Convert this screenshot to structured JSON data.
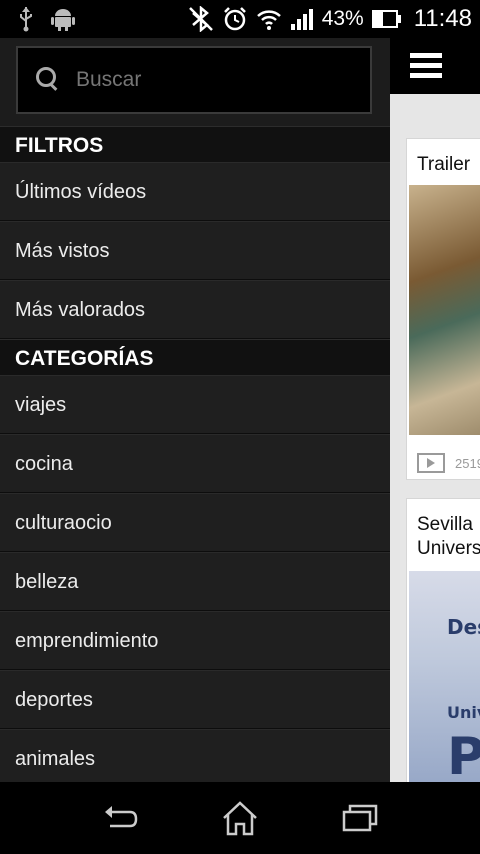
{
  "status_bar": {
    "battery": "43%",
    "time": "11:48",
    "icons": [
      "usb-icon",
      "android-debug-icon",
      "bluetooth-icon",
      "alarm-icon",
      "wifi-icon",
      "signal-icon",
      "battery-charging-icon"
    ]
  },
  "drawer": {
    "search": {
      "placeholder": "Buscar",
      "value": ""
    },
    "sections": [
      {
        "title": "FILTROS",
        "items": [
          "Últimos vídeos",
          "Más vistos",
          "Más valorados"
        ]
      },
      {
        "title": "CATEGORÍAS",
        "items": [
          "viajes",
          "cocina",
          "culturaocio",
          "belleza",
          "emprendimiento",
          "deportes",
          "animales"
        ]
      }
    ]
  },
  "main": {
    "cards": [
      {
        "title": "Trailer",
        "views": "2519"
      },
      {
        "title_line1": "Sevilla",
        "title_line2": "Univers",
        "thumb_text_1": "Des",
        "thumb_text_2": "Univ",
        "thumb_text_3": "P"
      }
    ]
  },
  "colors": {
    "drawer_bg": "#1c1c1c",
    "section_bg": "#111111",
    "content_bg": "#e6e6e6"
  }
}
